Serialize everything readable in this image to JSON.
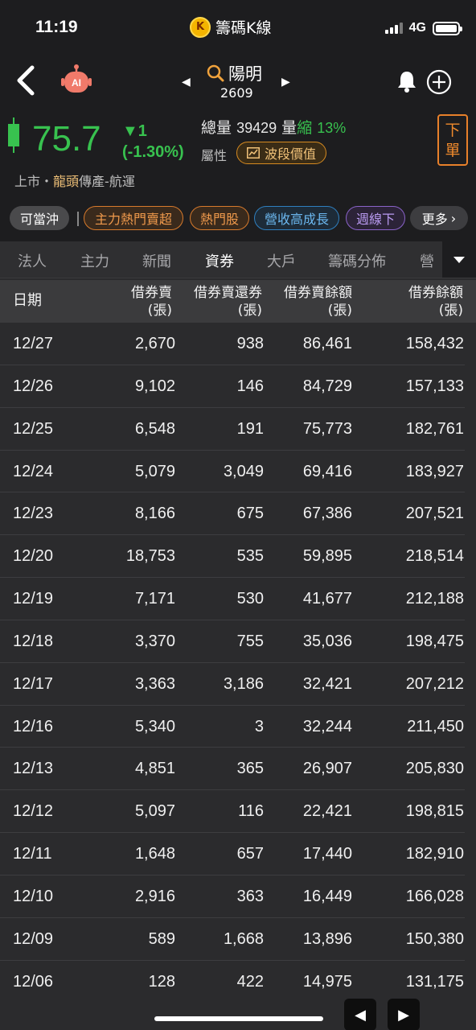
{
  "status_bar": {
    "time": "11:19",
    "app_name": "籌碼K線",
    "app_logo_letter": "K",
    "network": "4G"
  },
  "header": {
    "stock_name": "陽明",
    "stock_code": "2609",
    "robot_label": "AI",
    "price": "75.7",
    "change": "▼1",
    "change_pct": "(-1.30%)",
    "volume_label": "總量",
    "volume_value": "39429",
    "volume_ratio_label": "量",
    "volume_ratio_word": "縮",
    "volume_ratio_value": "13%",
    "attribute_label": "屬性",
    "wave_button": "波段價值",
    "order_button_top": "下",
    "order_button_bottom": "單",
    "market": "上市",
    "dot": "・",
    "sector_highlight": "龍頭",
    "sector_rest": "傳產-航運",
    "price_color": "#38c24f"
  },
  "tags": [
    {
      "label": "可當沖"
    },
    {
      "label": "主力熱門賣超"
    },
    {
      "label": "熱門股"
    },
    {
      "label": "營收高成長"
    },
    {
      "label": "週線下"
    },
    {
      "label": "更多"
    }
  ],
  "tabs": [
    {
      "label": "法人"
    },
    {
      "label": "主力"
    },
    {
      "label": "新聞"
    },
    {
      "label": "資券",
      "active": true
    },
    {
      "label": "大戶"
    },
    {
      "label": "籌碼分佈"
    },
    {
      "label": "營"
    }
  ],
  "table": {
    "headers": {
      "date": "日期",
      "col1_line1": "借券賣",
      "col1_line2": "(張)",
      "col2_line1": "借券賣還券",
      "col2_line2": "(張)",
      "col3_line1": "借券賣餘額",
      "col3_line2": "(張)",
      "col4_line1": "借券餘額",
      "col4_line2": "(張)"
    },
    "rows": [
      [
        "12/27",
        "2,670",
        "938",
        "86,461",
        "158,432"
      ],
      [
        "12/26",
        "9,102",
        "146",
        "84,729",
        "157,133"
      ],
      [
        "12/25",
        "6,548",
        "191",
        "75,773",
        "182,761"
      ],
      [
        "12/24",
        "5,079",
        "3,049",
        "69,416",
        "183,927"
      ],
      [
        "12/23",
        "8,166",
        "675",
        "67,386",
        "207,521"
      ],
      [
        "12/20",
        "18,753",
        "535",
        "59,895",
        "218,514"
      ],
      [
        "12/19",
        "7,171",
        "530",
        "41,677",
        "212,188"
      ],
      [
        "12/18",
        "3,370",
        "755",
        "35,036",
        "198,475"
      ],
      [
        "12/17",
        "3,363",
        "3,186",
        "32,421",
        "207,212"
      ],
      [
        "12/16",
        "5,340",
        "3",
        "32,244",
        "211,450"
      ],
      [
        "12/13",
        "4,851",
        "365",
        "26,907",
        "205,830"
      ],
      [
        "12/12",
        "5,097",
        "116",
        "22,421",
        "198,815"
      ],
      [
        "12/11",
        "1,648",
        "657",
        "17,440",
        "182,910"
      ],
      [
        "12/10",
        "2,916",
        "363",
        "16,449",
        "166,028"
      ],
      [
        "12/09",
        "589",
        "1,668",
        "13,896",
        "150,380"
      ],
      [
        "12/06",
        "128",
        "422",
        "14,975",
        "131,175"
      ]
    ]
  },
  "pager": {
    "prev": "◀",
    "next": "▶"
  }
}
